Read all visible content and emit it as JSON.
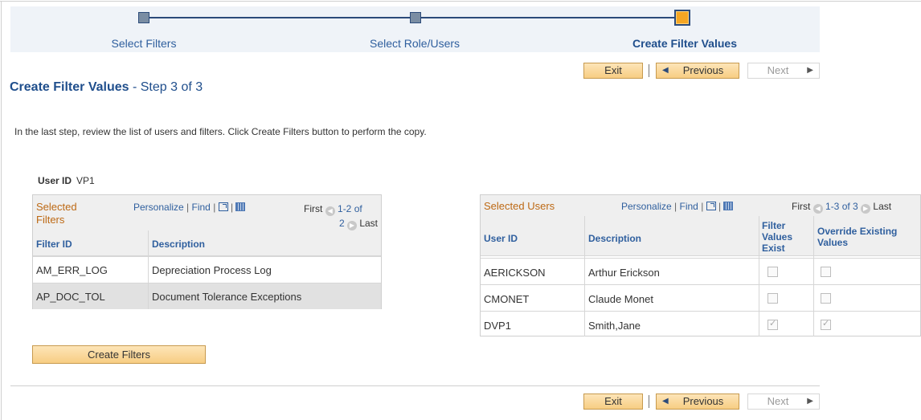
{
  "train": {
    "steps": [
      {
        "label": "Select Filters"
      },
      {
        "label": "Select Role/Users"
      },
      {
        "label": "Create Filter Values"
      }
    ]
  },
  "nav": {
    "exit_label": "Exit",
    "previous_label": "Previous",
    "next_label": "Next"
  },
  "page": {
    "title": "Create Filter Values",
    "step_text": " - Step 3 of 3",
    "instruction": "In the last step, review the list of users and filters.  Click Create Filters button to perform the copy.",
    "user_id_label": "User ID",
    "user_id_value": "VP1",
    "create_button_label": "Create Filters"
  },
  "filters_grid": {
    "title_line1": "Selected",
    "title_line2": "Filters",
    "personalize": "Personalize",
    "find": "Find",
    "first": "First",
    "range_a": "1-2 of",
    "range_b": "2",
    "last": "Last",
    "columns": [
      "Filter ID",
      "Description"
    ],
    "rows": [
      {
        "filter_id": "AM_ERR_LOG",
        "description": "Depreciation Process Log"
      },
      {
        "filter_id": "AP_DOC_TOL",
        "description": "Document Tolerance Exceptions"
      }
    ]
  },
  "users_grid": {
    "title": "Selected Users",
    "personalize": "Personalize",
    "find": "Find",
    "first": "First",
    "range": "1-3 of 3",
    "last": "Last",
    "columns": [
      "User ID",
      "Description",
      "Filter Values Exist",
      "Override Existing Values"
    ],
    "col_filter_lines": [
      "Filter",
      "Values",
      "Exist"
    ],
    "col_override_lines": [
      "Override Existing",
      "Values"
    ],
    "rows": [
      {
        "user_id": "AERICKSON",
        "description": "Arthur Erickson",
        "filter_values_exist": false,
        "override": false
      },
      {
        "user_id": "CMONET",
        "description": "Claude Monet",
        "filter_values_exist": false,
        "override": false
      },
      {
        "user_id": "DVP1",
        "description": "Smith,Jane",
        "filter_values_exist": true,
        "override": true
      }
    ]
  },
  "colors": {
    "accent": "#1f4e8c",
    "grid_title": "#bd6914",
    "button": "#f7cd83",
    "current_step": "#f5a623"
  }
}
